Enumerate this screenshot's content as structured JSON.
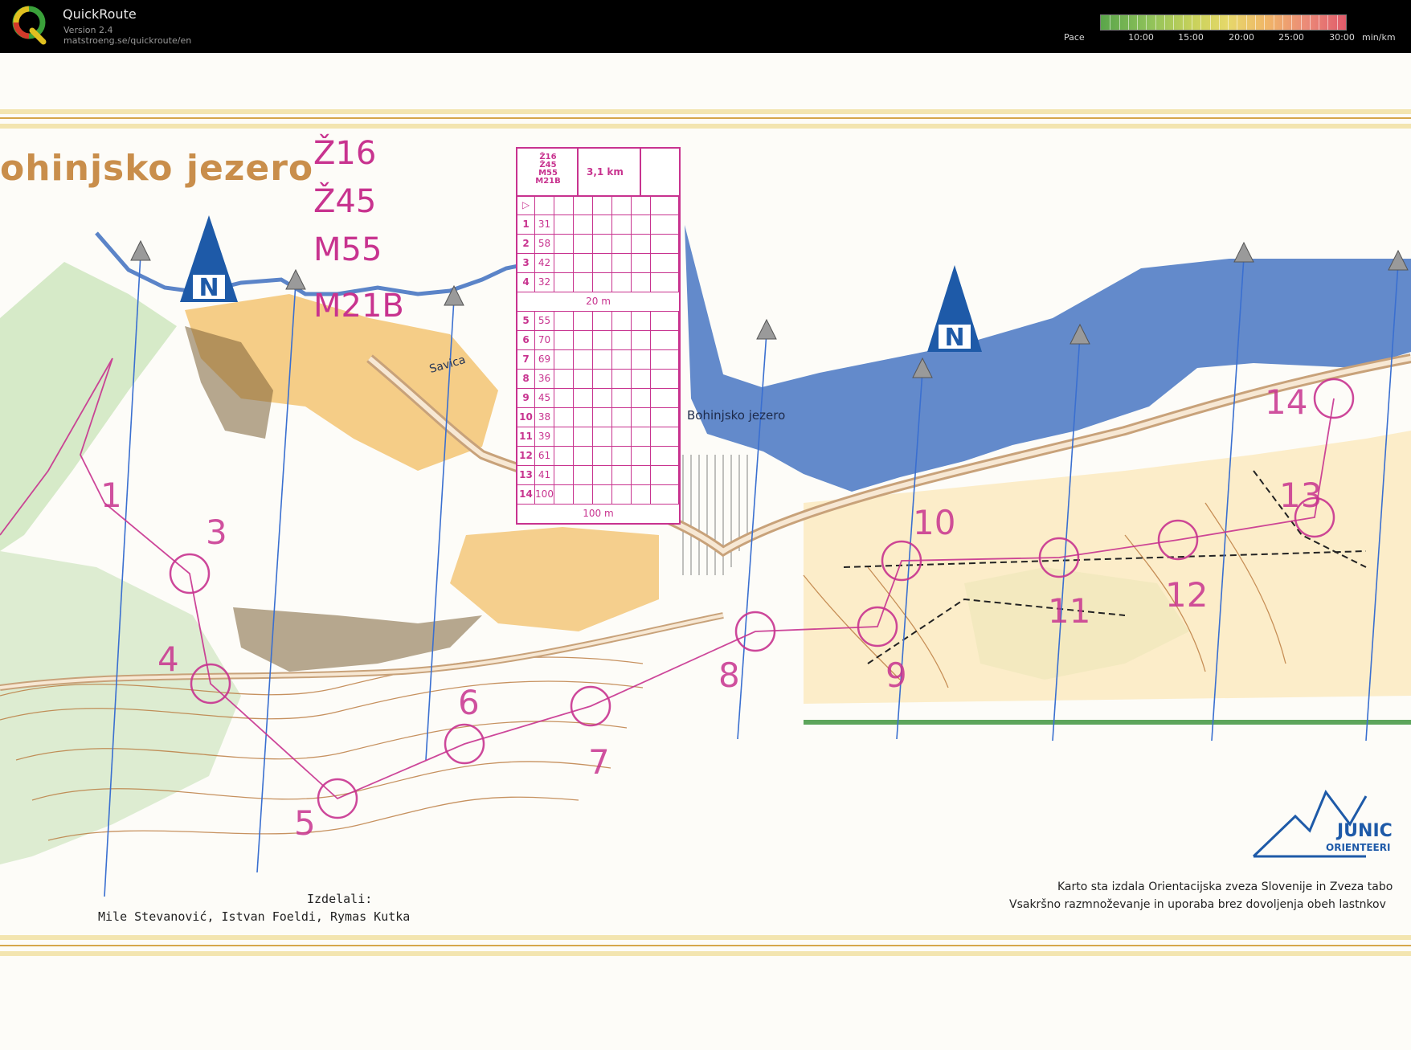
{
  "app": {
    "name": "QuickRoute",
    "version": "Version 2.4",
    "url": "matstroeng.se/quickroute/en"
  },
  "pace_scale": {
    "label": "Pace",
    "ticks": [
      "10:00",
      "15:00",
      "20:00",
      "25:00",
      "30:00"
    ],
    "unit": "min/km",
    "colors": [
      "#5aa54a",
      "#c9d25b",
      "#f0b568",
      "#e05b6a"
    ]
  },
  "map": {
    "title": "ohinjsko jezero",
    "classes": [
      "Ž16",
      "Ž45",
      "M55",
      "M21B"
    ],
    "lake_label": "Bohinjsko jezero",
    "river_label": "Savica",
    "credits_heading": "Izdelali:",
    "credits_names": "Mile Stevanović, Istvan Foeldi, Rymas Kutka",
    "copyright_line1": "Karto sta izdala Orientacijska zveza Slovenije in Zveza tabo",
    "copyright_line2": "Vsakršno razmnoževanje in uporaba brez dovoljenja obeh lastnkov",
    "logo_line1": "JUNIC",
    "logo_line2": "ORIENTEERI",
    "north_symbol": "N",
    "course_color": "#c8338f",
    "water_color": "#5b84c8"
  },
  "control_numbers": [
    "1",
    "3",
    "4",
    "5",
    "6",
    "7",
    "8",
    "9",
    "10",
    "11",
    "12",
    "13",
    "14"
  ],
  "control_description": {
    "classes_text": [
      "Ž16",
      "Ž45",
      "M55",
      "M21B"
    ],
    "distance": "3,1 km",
    "rows": [
      {
        "n": "1",
        "code": "31"
      },
      {
        "n": "2",
        "code": "58"
      },
      {
        "n": "3",
        "code": "42"
      },
      {
        "n": "4",
        "code": "32"
      },
      {
        "n": "5",
        "code": "55"
      },
      {
        "n": "6",
        "code": "70"
      },
      {
        "n": "7",
        "code": "69"
      },
      {
        "n": "8",
        "code": "36"
      },
      {
        "n": "9",
        "code": "45"
      },
      {
        "n": "10",
        "code": "38"
      },
      {
        "n": "11",
        "code": "39"
      },
      {
        "n": "12",
        "code": "61"
      },
      {
        "n": "13",
        "code": "41"
      },
      {
        "n": "14",
        "code": "100"
      }
    ],
    "taped_route_1": "20 m",
    "taped_route_finish": "100 m"
  }
}
